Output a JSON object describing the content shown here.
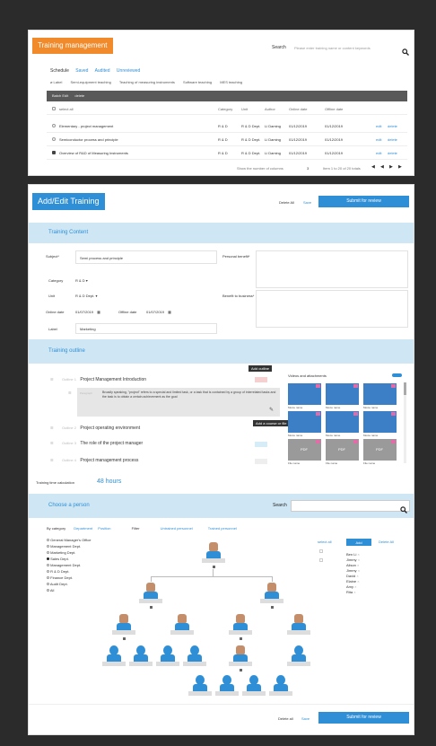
{
  "training_management": {
    "title": "Training management",
    "search_label": "Search",
    "search_placeholder": "Please enter training name or content keywords",
    "tabs": [
      "Schedule",
      "Saved",
      "Audited",
      "Unreviewed"
    ],
    "filter_label": "Label",
    "filters": [
      "Semi-equipment teaching",
      "Teaching of measuring instruments",
      "Software teaching",
      "MES teaching"
    ],
    "batch_edit": "Batch Edit",
    "delete": "delete",
    "select_all": "select all",
    "columns": [
      "Category",
      "Unit",
      "Author",
      "Online date",
      "Offline date"
    ],
    "rows": [
      {
        "name": "Elementary - project management",
        "category": "R & D",
        "unit": "R & D Dept.",
        "author": "Li Daming",
        "online": "01/12/2019",
        "offline": "01/12/2019"
      },
      {
        "name": "Semiconductor process and principle",
        "category": "R & D",
        "unit": "R & D Dept.",
        "author": "Li Daming",
        "online": "01/12/2019",
        "offline": "01/12/2019"
      },
      {
        "name": "Overview of R&D of Measuring Instruments",
        "category": "R & D",
        "unit": "R & D Dept.",
        "author": "Li Daming",
        "online": "01/12/2019",
        "offline": "01/12/2019"
      }
    ],
    "row_edit": "edit",
    "row_delete": "delete",
    "pagination_label": "Show the number of columns",
    "page_size": "3",
    "page_info": "Item 1 to 20 of 20 totals"
  },
  "add_edit": {
    "title": "Add/Edit Training",
    "delete_all": "Delete All",
    "save": "Save",
    "submit": "Submit for review",
    "content_header": "Training Content",
    "subject_label": "Subject*",
    "subject_value": "Semi process and principle",
    "personal_benefit_label": "Personal benefit*",
    "category_label": "Category",
    "category_value": "R & D",
    "unit_label": "Unit",
    "unit_value": "R & D Dept.",
    "benefit_business_label": "Benefit to business*",
    "online_label": "Online date",
    "online_value": "01/07/2019",
    "offline_label": "Offline date",
    "offline_value": "01/07/2019",
    "label_label": "Label",
    "label_value": "Marketing",
    "outline_header": "Training outline",
    "add_outline_tip": "Add outline",
    "add_course_tip": "Add a course or file",
    "outline": [
      {
        "num": "Outline 1",
        "title": "Project Management Introduction"
      },
      {
        "num": "Outline 2",
        "title": "Project operating environment"
      },
      {
        "num": "Outline 3",
        "title": "The role of the project manager"
      },
      {
        "num": "Outline 4",
        "title": "Project management process"
      }
    ],
    "paragraph_num": "Paragraph",
    "paragraph": "Broadly speaking, \"project\" refers to a special and limited task, or a task that is contained by a group of interrelated tasks and the task is to obtain a certain achievement as the goal",
    "videos_label": "Videos and attachments",
    "video_name": "Movie name",
    "file_name": "File name",
    "file_type": "PDF",
    "time_calc_label": "Training time calculation",
    "time_calc_value": "48 hours"
  },
  "choose_person": {
    "title": "Choose a person",
    "search_label": "Search",
    "by_category": "By category",
    "department": "Department",
    "position": "Position",
    "filter": "Filter",
    "untrained": "Untrained personnel",
    "trained": "Trained personnel",
    "departments": [
      "General Manager's Office",
      "Management Dept.",
      "Marketing Dept.",
      "Sales Dept.",
      "Management Dept.",
      "R & D Dept.",
      "Finance Dept.",
      "Audit Dept.",
      "All"
    ],
    "select_all": "select all",
    "add": "Add",
    "delete_all": "Delete All",
    "people": [
      "Ben Li",
      "Jimmy",
      "Alison",
      "Jimmy",
      "David",
      "Elaine",
      "Amy",
      "Rita"
    ],
    "delete_all_bottom": "Delete all",
    "save": "Save",
    "submit": "Submit for review"
  },
  "colors": {
    "accent": "#2f8fd6",
    "orange": "#f08a2b",
    "light": "#cfe6f4"
  }
}
